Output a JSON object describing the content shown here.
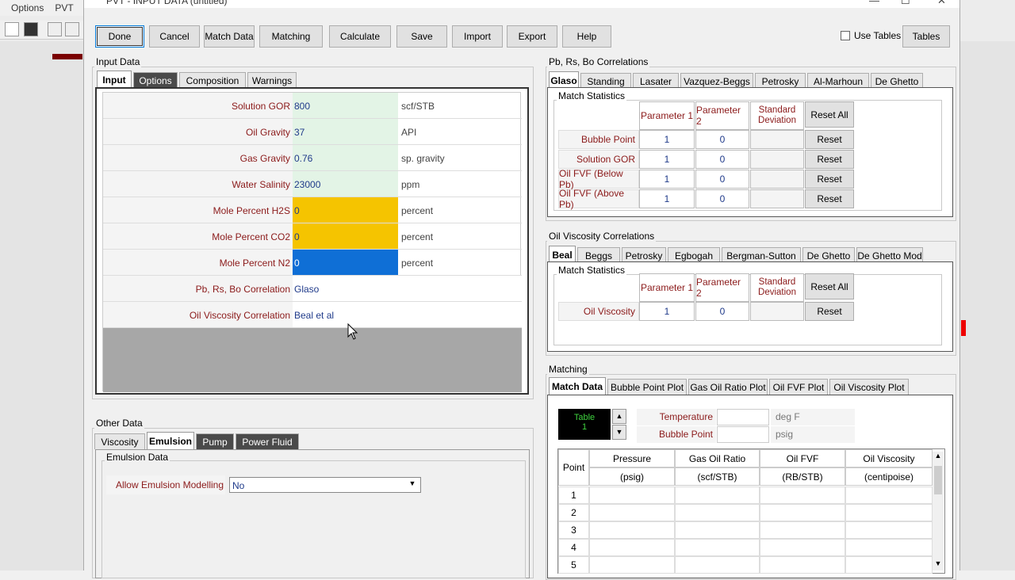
{
  "bg_menu": [
    "Options",
    "PVT"
  ],
  "window": {
    "title": "PVT - INPUT DATA (untitled)"
  },
  "toolbar": {
    "done": "Done",
    "cancel": "Cancel",
    "match_data": "Match Data",
    "matching": "Matching",
    "calculate": "Calculate",
    "save": "Save",
    "import": "Import",
    "export": "Export",
    "help": "Help",
    "use_tables": "Use Tables",
    "tables": "Tables"
  },
  "input_data": {
    "group": "Input Data",
    "tabs": [
      "Input",
      "Options",
      "Composition",
      "Warnings"
    ],
    "rows": [
      {
        "label": "Solution GOR",
        "value": "800",
        "unit": "scf/STB"
      },
      {
        "label": "Oil Gravity",
        "value": "37",
        "unit": "API"
      },
      {
        "label": "Gas Gravity",
        "value": "0.76",
        "unit": "sp. gravity"
      },
      {
        "label": "Water Salinity",
        "value": "23000",
        "unit": "ppm"
      },
      {
        "label": "Mole Percent H2S",
        "value": "0",
        "unit": "percent"
      },
      {
        "label": "Mole Percent CO2",
        "value": "0",
        "unit": "percent"
      },
      {
        "label": "Mole Percent N2",
        "value": "0",
        "unit": "percent"
      },
      {
        "label": "Pb, Rs, Bo Correlation",
        "value": "Glaso",
        "unit": ""
      },
      {
        "label": "Oil Viscosity Correlation",
        "value": "Beal et al",
        "unit": ""
      }
    ],
    "colors": {
      "green": "#e3f4e6",
      "yellow": "#f5c400",
      "blue": "#0f6fd6"
    }
  },
  "other_data": {
    "group": "Other Data",
    "tabs": [
      "Viscosity",
      "Emulsion",
      "Pump",
      "Power Fluid"
    ],
    "sub_group": "Emulsion Data",
    "field_label": "Allow Emulsion Modelling",
    "field_value": "No"
  },
  "pb_corr": {
    "group": "Pb, Rs, Bo Correlations",
    "tabs": [
      "Glaso",
      "Standing",
      "Lasater",
      "Vazquez-Beggs",
      "Petrosky",
      "Al-Marhoun",
      "De Ghetto"
    ],
    "sub_group": "Match Statistics",
    "headers": [
      "Parameter 1",
      "Parameter 2",
      "Standard Deviation"
    ],
    "reset_all": "Reset All",
    "reset": "Reset",
    "rows": [
      {
        "label": "Bubble Point",
        "p1": "1",
        "p2": "0"
      },
      {
        "label": "Solution GOR",
        "p1": "1",
        "p2": "0"
      },
      {
        "label": "Oil FVF (Below Pb)",
        "p1": "1",
        "p2": "0"
      },
      {
        "label": "Oil FVF (Above Pb)",
        "p1": "1",
        "p2": "0"
      }
    ]
  },
  "visc_corr": {
    "group": "Oil Viscosity Correlations",
    "tabs": [
      "Beal",
      "Beggs",
      "Petrosky",
      "Egbogah",
      "Bergman-Sutton",
      "De Ghetto",
      "De Ghetto Mod"
    ],
    "sub_group": "Match Statistics",
    "headers": [
      "Parameter 1",
      "Parameter 2",
      "Standard Deviation"
    ],
    "reset_all": "Reset All",
    "reset": "Reset",
    "rows": [
      {
        "label": "Oil Viscosity",
        "p1": "1",
        "p2": "0"
      }
    ]
  },
  "matching": {
    "group": "Matching",
    "tabs": [
      "Match Data",
      "Bubble Point Plot",
      "Gas Oil Ratio Plot",
      "Oil FVF Plot",
      "Oil Viscosity Plot"
    ],
    "table_label": "Table",
    "table_num": "1",
    "temperature": {
      "label": "Temperature",
      "unit": "deg F"
    },
    "bubble_point": {
      "label": "Bubble Point",
      "unit": "psig"
    },
    "columns": [
      {
        "name": "Point",
        "unit": ""
      },
      {
        "name": "Pressure",
        "unit": "(psig)"
      },
      {
        "name": "Gas Oil Ratio",
        "unit": "(scf/STB)"
      },
      {
        "name": "Oil FVF",
        "unit": "(RB/STB)"
      },
      {
        "name": "Oil Viscosity",
        "unit": "(centipoise)"
      }
    ],
    "points": [
      "1",
      "2",
      "3",
      "4",
      "5"
    ]
  }
}
